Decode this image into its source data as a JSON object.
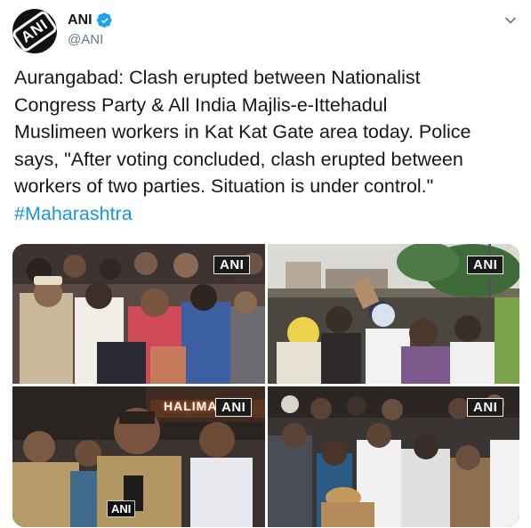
{
  "tweet": {
    "avatar_text": "ANI",
    "display_name": "ANI",
    "handle": "@ANI",
    "body_lines": [
      "Aurangabad: Clash erupted between Nationalist",
      "Congress Party & All India Majlis-e-Ittehadul",
      "Muslimeen workers in Kat Kat Gate area today. Police",
      "says, \"After voting concluded, clash erupted between",
      "workers of two parties. Situation is under control.\""
    ],
    "hashtag": "#Maharashtra"
  },
  "media": {
    "badge": "ANI",
    "photo3_sign": "HALIMAR",
    "photo3_mic_label": "ANI"
  },
  "colors": {
    "link": "#1b95e0",
    "verified": "#1da1f2",
    "handle": "#657786"
  },
  "icons": {
    "verified": "verified-badge-icon",
    "menu": "chevron-down-icon"
  }
}
